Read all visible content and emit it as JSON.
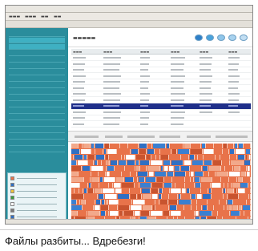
{
  "caption": "Файлы разбиты... Вдребезги!",
  "colors": {
    "sidebar": "#2a8d9c",
    "selection": "#1f2f8a",
    "fragmented": "#e8734a",
    "contiguous": "#2f6fc3"
  },
  "toolbar_icons": [
    "blue-disc-icon",
    "blue-disc-icon",
    "blue-disc-icon",
    "blue-disc-icon",
    "blue-disc-icon"
  ],
  "legend_swatches": [
    "#e8734a",
    "#2f6fc3",
    "#f0c23a",
    "#3b9b3b",
    "#ffffff",
    "#7a7a7a",
    "#2f6fc3"
  ]
}
